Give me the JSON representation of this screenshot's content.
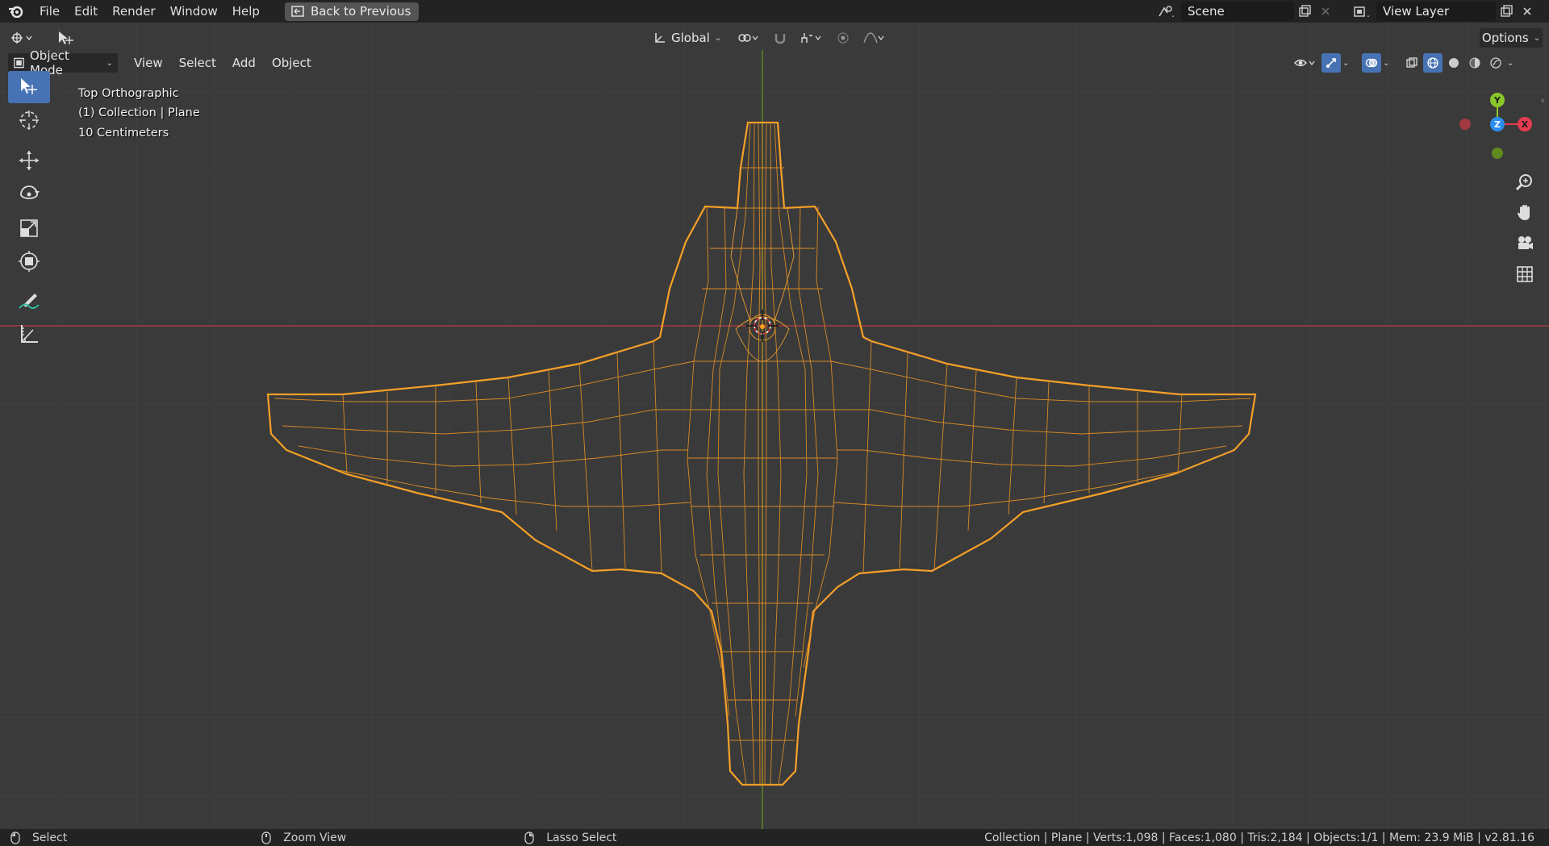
{
  "topbar": {
    "menus": [
      "File",
      "Edit",
      "Render",
      "Window",
      "Help"
    ],
    "back_button": "Back to Previous",
    "scene_name": "Scene",
    "view_layer_name": "View Layer"
  },
  "header": {
    "transform_orientation": "Global",
    "options_label": "Options",
    "mode": "Object Mode",
    "menus": [
      "View",
      "Select",
      "Add",
      "Object"
    ]
  },
  "viewport_overlay": {
    "view_name": "Top Orthographic",
    "collection_info": "(1) Collection | Plane",
    "grid_scale": "10 Centimeters"
  },
  "gizmo": {
    "y_label": "Y",
    "z_label": "Z",
    "x_label": "X",
    "colors": {
      "x": "#e43c4f",
      "y": "#8bc72a",
      "z": "#2a8ef0"
    }
  },
  "toolbar": {
    "tools": [
      "select-box-icon",
      "cursor-icon",
      "move-icon",
      "rotate-icon",
      "scale-icon",
      "transform-icon",
      "annotate-icon",
      "measure-icon"
    ]
  },
  "navigation": [
    "zoom-icon",
    "hand-pan-icon",
    "camera-icon",
    "grid-icon"
  ],
  "statusbar": {
    "select": "Select",
    "zoom_view": "Zoom View",
    "lasso_select": "Lasso Select",
    "stats": "Collection | Plane | Verts:1,098 | Faces:1,080 | Tris:2,184 | Objects:1/1 | Mem: 23.9 MiB | v2.81.16"
  },
  "colors": {
    "accent": "#4772b3",
    "selection_wire": "#f5a028",
    "x_axis_line": "#a33a42",
    "y_axis_line": "#5e8a1e"
  }
}
